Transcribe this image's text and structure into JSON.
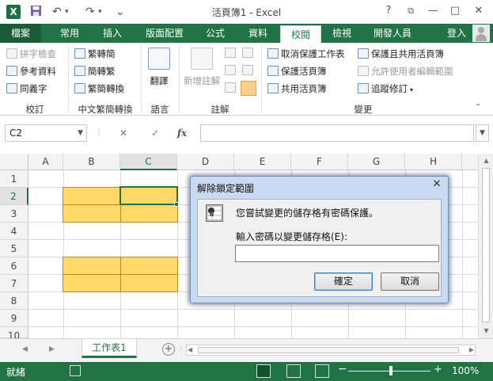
{
  "window": {
    "title": "活頁簿1 - Excel",
    "app_icon": "X",
    "help": "?",
    "restore_ribbon": "⧉",
    "minimize": "—",
    "maximize": "□",
    "close": "✕"
  },
  "quick_access": {
    "save_icon": "save-icon",
    "undo": "↶",
    "redo": "↷",
    "customize": "⌄"
  },
  "tabs": [
    {
      "label": "檔案"
    },
    {
      "label": "常用"
    },
    {
      "label": "插入"
    },
    {
      "label": "版面配置"
    },
    {
      "label": "公式"
    },
    {
      "label": "資料"
    },
    {
      "label": "校閱"
    },
    {
      "label": "檢視"
    },
    {
      "label": "開發人員"
    }
  ],
  "active_tab": "校閱",
  "login": "登入",
  "ribbon": {
    "proofing": {
      "spell": "拼字檢查",
      "research": "參考資料",
      "thesaurus": "同義字",
      "label": "校訂"
    },
    "chinese": {
      "t2s": "繁轉簡",
      "s2t": "簡轉繁",
      "convert": "繁簡轉換",
      "label": "中文繁簡轉換"
    },
    "language": {
      "translate": "翻譯",
      "label": "語言"
    },
    "comments": {
      "new": "新增註解",
      "label": "註解"
    },
    "changes": {
      "unprotect_sheet": "取消保護工作表",
      "protect_workbook": "保護活頁簿",
      "share_workbook": "共用活頁簿",
      "protect_share": "保護且共用活頁簿",
      "allow_edit": "允許使用者編輯範圍",
      "track": "追蹤修訂",
      "label": "變更"
    }
  },
  "formula_bar": {
    "name_box": "C2",
    "cancel": "✕",
    "enter": "✓",
    "fx": "fx",
    "value": ""
  },
  "sheet": {
    "columns": [
      "A",
      "B",
      "C",
      "D",
      "E",
      "F",
      "G",
      "H"
    ],
    "rows": [
      "1",
      "2",
      "3",
      "4",
      "5",
      "6",
      "7",
      "8",
      "9",
      "10"
    ],
    "selected_cell": "C2"
  },
  "sheet_tabs": [
    {
      "label": "工作表1"
    }
  ],
  "add_sheet": "+",
  "status": {
    "ready": "就緒",
    "zoom": "100%",
    "minus": "−",
    "plus": "+"
  },
  "dialog": {
    "title": "解除鎖定範圍",
    "close": "✕",
    "message": "您嘗試變更的儲存格有密碼保護。",
    "label": "輸入密碼以變更儲存格(E):",
    "password_value": "",
    "ok": "確定",
    "cancel": "取消"
  }
}
